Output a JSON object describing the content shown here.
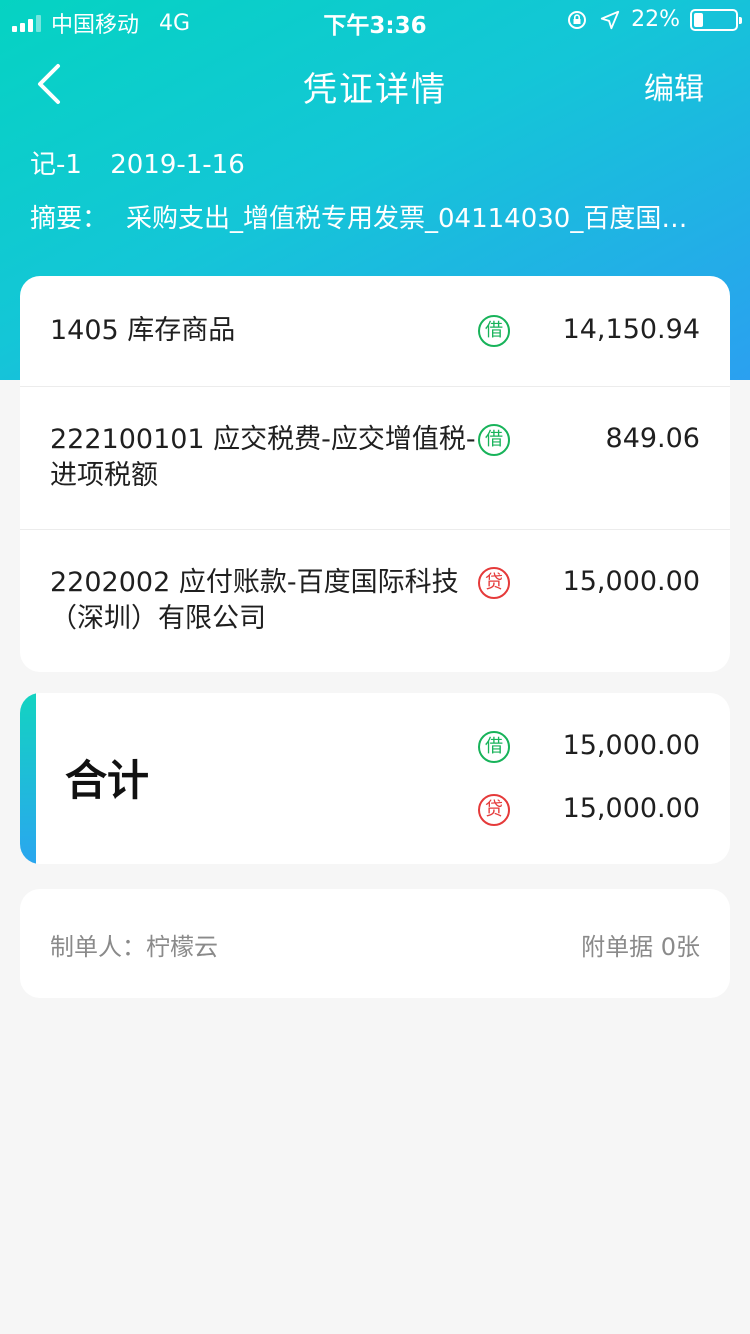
{
  "status_bar": {
    "carrier": "中国移动",
    "network": "4G",
    "time": "下午3:36",
    "battery": "22%",
    "battery_level": 0.22,
    "signal_bars": 3
  },
  "nav": {
    "title": "凭证详情",
    "edit_label": "编辑"
  },
  "voucher": {
    "number": "记-1",
    "date": "2019-1-16",
    "summary_label": "摘要：",
    "summary": "采购支出_增值税专用发票_04114030_百度国…"
  },
  "entries": [
    {
      "account": "1405 库存商品",
      "side": "借",
      "amount": "14,150.94"
    },
    {
      "account": "222100101 应交税费-应交增值税-进项税额",
      "side": "借",
      "amount": "849.06"
    },
    {
      "account": "2202002 应付账款-百度国际科技（深圳）有限公司",
      "side": "贷",
      "amount": "15,000.00"
    }
  ],
  "total": {
    "label": "合计",
    "debit_label": "借",
    "debit_amount": "15,000.00",
    "credit_label": "贷",
    "credit_amount": "15,000.00"
  },
  "footer": {
    "maker": "制单人：柠檬云",
    "attachments": "附单据 0张"
  },
  "colors": {
    "gradient_start": "#05d3c2",
    "gradient_end": "#2ba0f0",
    "debit": "#18b35a",
    "credit": "#e53a3a"
  }
}
